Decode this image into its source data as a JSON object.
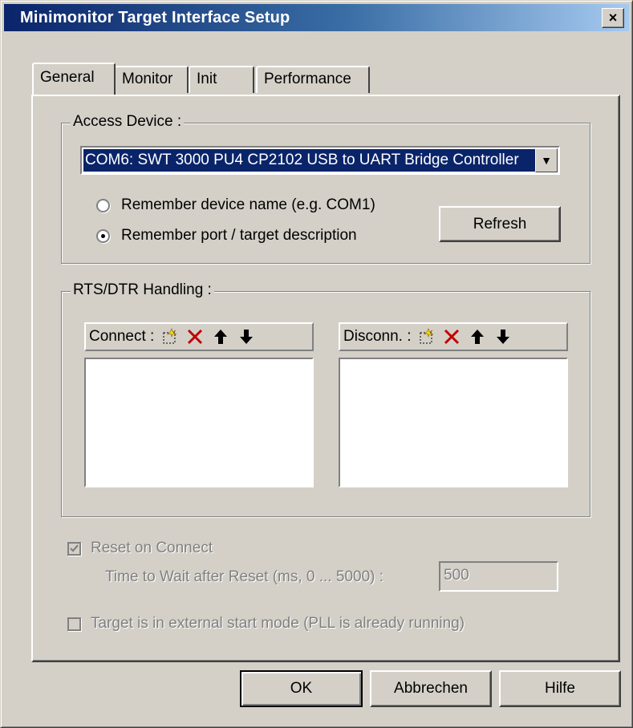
{
  "window": {
    "title": "Minimonitor Target Interface Setup",
    "close_label": "×"
  },
  "tabs": [
    {
      "label": "General",
      "active": true
    },
    {
      "label": "Monitor",
      "active": false
    },
    {
      "label": "Init",
      "active": false
    },
    {
      "label": "Performance",
      "active": false
    }
  ],
  "access_device": {
    "legend": "Access Device :",
    "selected": "COM6: SWT 3000 PU4 CP2102 USB to UART Bridge Controller",
    "radio_name": "Remember device name (e.g. COM1)",
    "radio_port": "Remember port / target description",
    "selected_radio": "port",
    "refresh_label": "Refresh"
  },
  "rts_dtr": {
    "legend": "RTS/DTR Handling :",
    "connect_label": "Connect :",
    "disconnect_label": "Disconn. :",
    "connect_items": [],
    "disconnect_items": []
  },
  "reset": {
    "label": "Reset on Connect",
    "checked": true,
    "enabled": false,
    "wait_label": "Time to Wait after Reset (ms, 0 ... 5000) :",
    "wait_value": "500"
  },
  "external_start": {
    "label": "Target is in external start mode (PLL is already running)",
    "checked": false,
    "enabled": false
  },
  "buttons": {
    "ok": "OK",
    "cancel": "Abbrechen",
    "help": "Hilfe"
  },
  "colors": {
    "title_start": "#0a246a",
    "title_end": "#a6caf0",
    "delete_icon": "#c00000",
    "face": "#d4d0c8"
  },
  "icons": {
    "new": "new-item-icon",
    "delete": "delete-icon",
    "up": "move-up-icon",
    "down": "move-down-icon",
    "dropdown": "dropdown-arrow-icon"
  }
}
